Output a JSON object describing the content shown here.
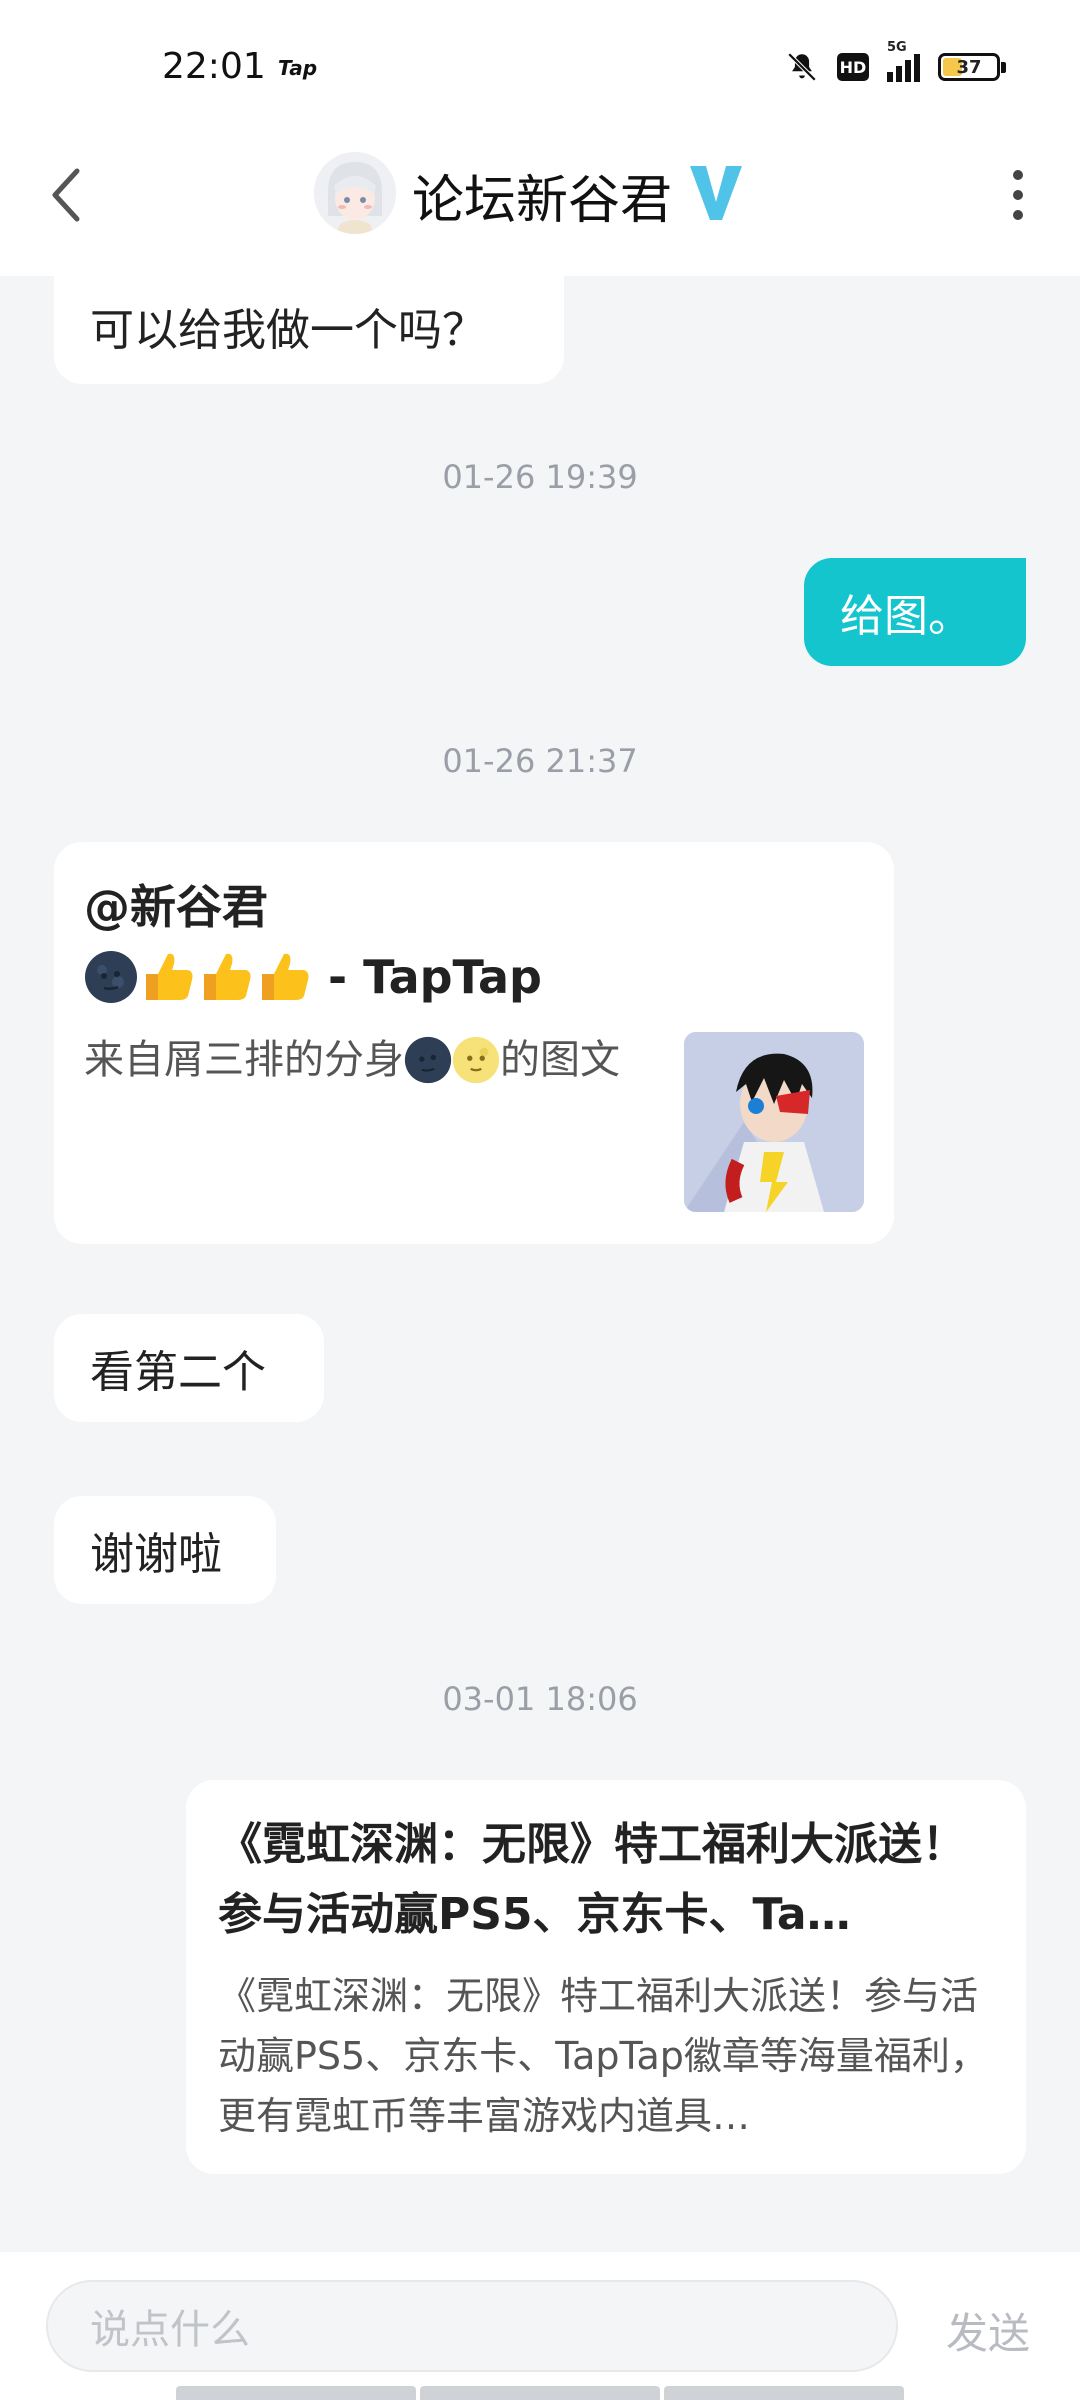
{
  "status_bar": {
    "time": "22:01",
    "app_tag": "Tap",
    "hd": "HD",
    "network": "5G",
    "battery": "37",
    "battery_level": 0.37
  },
  "header": {
    "title": "论坛新谷君",
    "back_icon": "chevron-left-icon",
    "more_icon": "more-vertical-icon",
    "verified_icon": "verified-v-icon"
  },
  "messages": {
    "m1": "可以给我做一个吗？",
    "ts1": "01-26 19:39",
    "m2": "给图。",
    "ts2": "01-26 21:37",
    "card1": {
      "line1": "@新谷君",
      "line2_suffix": " - TapTap",
      "desc_prefix": "来自屑三排的分身",
      "desc_suffix": "的图文"
    },
    "m3": "看第二个",
    "m4": "谢谢啦",
    "ts3": "03-01 18:06",
    "card2": {
      "title": "《霓虹深渊：无限》特工福利大派送！参与活动赢PS5、京东卡、Ta…",
      "desc": "《霓虹深渊：无限》特工福利大派送！参与活动赢PS5、京东卡、TapTap徽章等海量福利，更有霓虹币等丰富游戏内道具…"
    }
  },
  "input_bar": {
    "placeholder": "说点什么",
    "send_label": "发送"
  },
  "colors": {
    "accent": "#15c5ce",
    "background": "#f4f5f7",
    "verified": "#4fc3e8"
  }
}
